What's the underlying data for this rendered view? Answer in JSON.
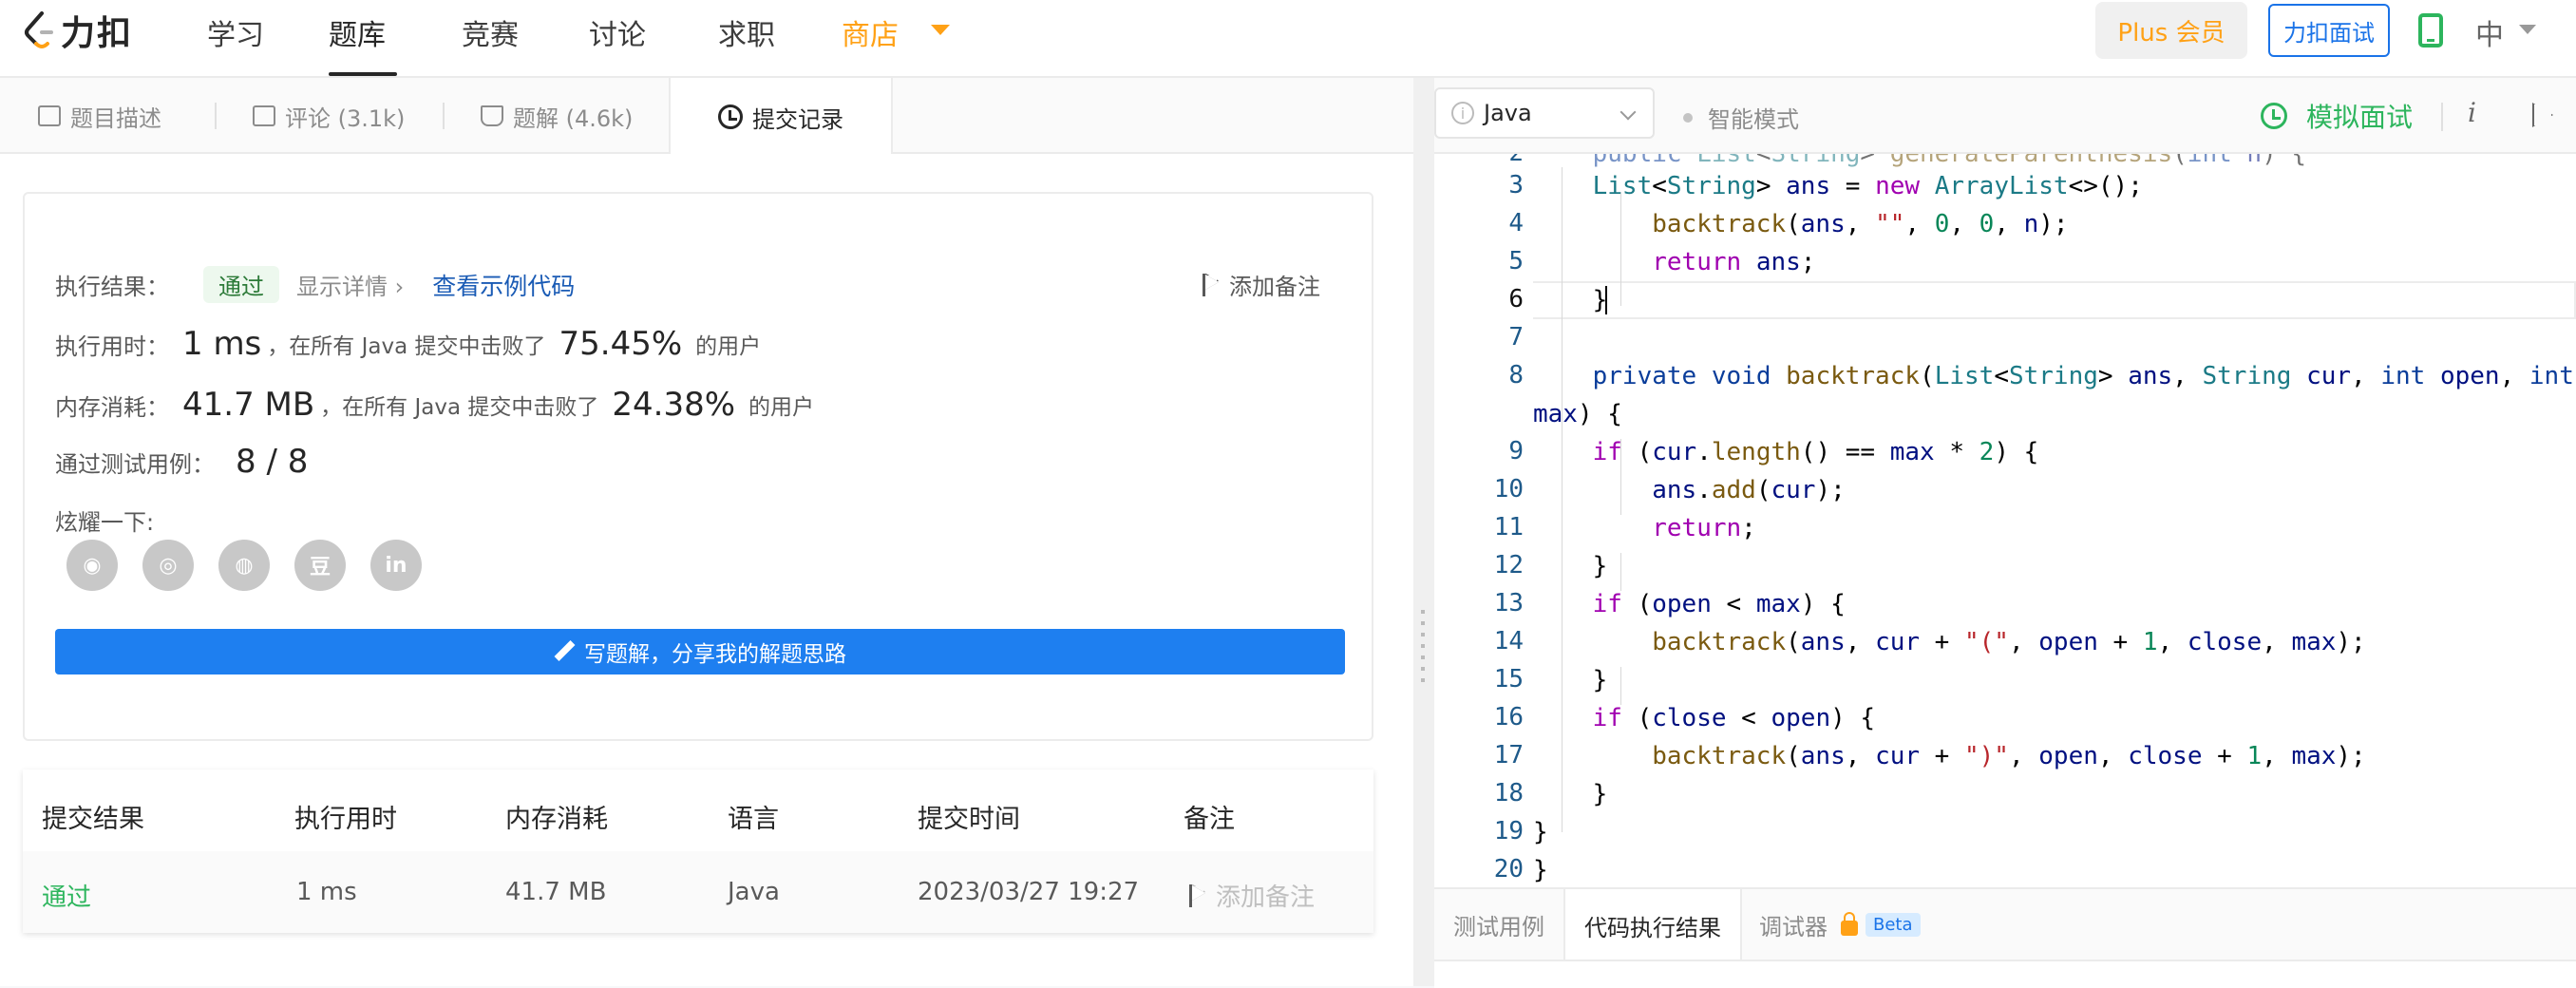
{
  "brand": {
    "name": "力扣"
  },
  "nav": {
    "items": [
      "学习",
      "题库",
      "竞赛",
      "讨论",
      "求职",
      "商店"
    ],
    "plus": "Plus 会员",
    "interview": "力扣面试",
    "lang": "中"
  },
  "left_tabs": [
    "题目描述",
    "评论 (3.1k)",
    "题解 (4.6k)",
    "提交记录"
  ],
  "result": {
    "label": "执行结果：",
    "status": "通过",
    "detail": "显示详情 ›",
    "example": "查看示例代码",
    "add_note": "添加备注",
    "time_label": "执行用时：",
    "time_value": "1 ms",
    "time_mid": "，在所有 Java 提交中击败了",
    "time_pct": "75.45%",
    "time_tail": "的用户",
    "mem_label": "内存消耗：",
    "mem_value": "41.7 MB",
    "mem_mid": "，在所有 Java 提交中击败了",
    "mem_pct": "24.38%",
    "mem_tail": "的用户",
    "tests_label": "通过测试用例：",
    "tests_value": "8 / 8",
    "share_label": "炫耀一下:",
    "write": "写题解，分享我的解题思路"
  },
  "share_icons": [
    "wechat-icon",
    "weibo-icon",
    "qq-icon",
    "douban-icon",
    "linkedin-icon"
  ],
  "share_glyphs": [
    "◉",
    "◎",
    "◍",
    "豆",
    "in"
  ],
  "table": {
    "headers": [
      "提交结果",
      "执行用时",
      "内存消耗",
      "语言",
      "提交时间",
      "备注"
    ],
    "rows": [
      {
        "result": "通过",
        "time": "1 ms",
        "memory": "41.7 MB",
        "language": "Java",
        "submitted": "2023/03/27 19:27",
        "note": "添加备注"
      }
    ]
  },
  "editor": {
    "language": "Java",
    "smart_mode": "智能模式",
    "mock": "模拟面试",
    "info": "i",
    "line_numbers": [
      "2",
      "3",
      "4",
      "5",
      "6",
      "7",
      "8",
      "",
      "9",
      "10",
      "11",
      "12",
      "13",
      "14",
      "15",
      "16",
      "17",
      "18",
      "19",
      "20"
    ]
  },
  "bottom_tabs": [
    "测试用例",
    "代码执行结果",
    "调试器"
  ],
  "beta": "Beta",
  "colors": {
    "accent": "#ffa116",
    "pass": "#2db55d",
    "primary": "#1e7ff0",
    "link": "#1a5bb5"
  }
}
